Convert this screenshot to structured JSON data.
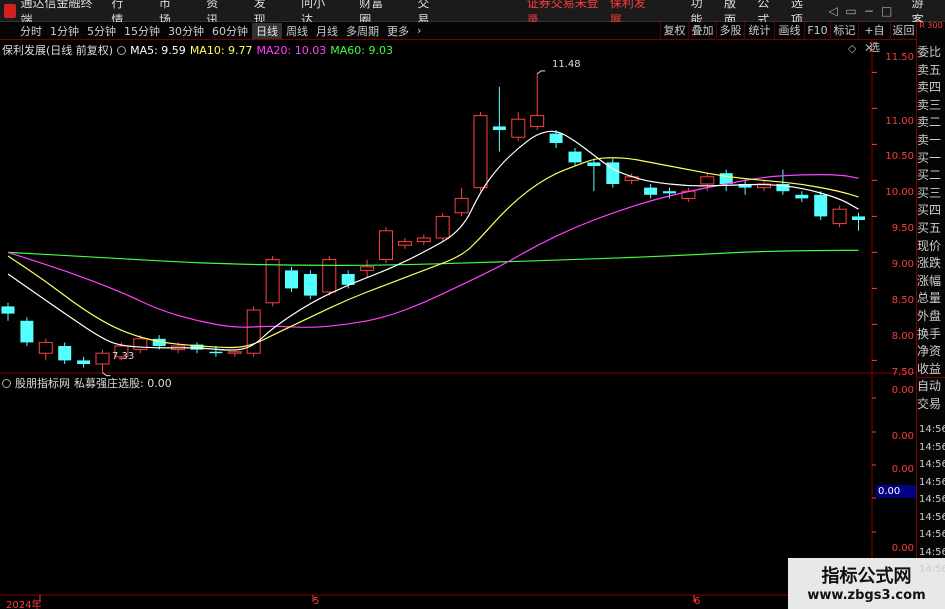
{
  "app": {
    "title": "通达信金融终端",
    "warning": "证券交易未登录",
    "stock": "保利发展",
    "guest": "游客"
  },
  "menu": [
    "行情",
    "市场",
    "资讯",
    "发现",
    "问小达",
    "财富圈",
    "交易"
  ],
  "right_menu": [
    "功能",
    "版面",
    "公式",
    "选项"
  ],
  "periods": [
    "分时",
    "1分钟",
    "5分钟",
    "15分钟",
    "30分钟",
    "60分钟",
    "日线",
    "周线",
    "月线",
    "多周期",
    "更多"
  ],
  "active_period": "日线",
  "toolbar_right": [
    "复权",
    "叠加",
    "多股",
    "统计",
    "画线",
    "F10",
    "标记",
    "+自选",
    "返回"
  ],
  "chart_header": {
    "title": "保利发展(日线 前复权)",
    "ma5": "MA5: 9.59",
    "ma10": "MA10: 9.77",
    "ma20": "MA20: 10.03",
    "ma60": "MA60: 9.03"
  },
  "indicator": {
    "name": "股朋指标网",
    "formula": "私募强庄选股: 0.00",
    "value_box": "0.00"
  },
  "annotations": {
    "high": "11.48",
    "low": "7.33"
  },
  "price_axis": [
    "11.50",
    "11.00",
    "10.50",
    "10.00",
    "9.50",
    "9.00",
    "8.50",
    "8.00",
    "7.50"
  ],
  "indicator_axis": [
    "0.00",
    "0.00",
    "0.00",
    "0.00"
  ],
  "x_labels": [
    "2024年",
    "5",
    "6"
  ],
  "side_panel": [
    "委比",
    "卖五",
    "卖四",
    "卖三",
    "卖二",
    "卖一",
    "买一",
    "买二",
    "买三",
    "买四",
    "买五",
    "现价",
    "涨跌",
    "涨幅",
    "总量",
    "外盘",
    "换手",
    "净资",
    "收益",
    "自动",
    "交易"
  ],
  "times": [
    "14:56",
    "14:56",
    "14:56",
    "14:56",
    "14:56",
    "14:56",
    "14:56",
    "14:56",
    "14:56"
  ],
  "side_top": "R 300",
  "watermark": {
    "line1": "指标公式网",
    "line2": "www.zbgs3.com"
  },
  "colors": {
    "up": "#ff4040",
    "down": "#54ffff",
    "ma5": "#ffffff",
    "ma10": "#ffff60",
    "ma20": "#ff40ff",
    "ma60": "#40ff40",
    "axis": "#ff3b3b",
    "frame": "#8b0000"
  },
  "chart_data": {
    "type": "candlestick",
    "ylim": [
      7.2,
      11.7
    ],
    "candles": [
      {
        "o": 8.25,
        "c": 8.15,
        "h": 8.3,
        "l": 8.05
      },
      {
        "o": 8.05,
        "c": 7.75,
        "h": 8.1,
        "l": 7.7
      },
      {
        "o": 7.6,
        "c": 7.75,
        "h": 7.8,
        "l": 7.5
      },
      {
        "o": 7.7,
        "c": 7.5,
        "h": 7.75,
        "l": 7.45
      },
      {
        "o": 7.5,
        "c": 7.45,
        "h": 7.55,
        "l": 7.4
      },
      {
        "o": 7.45,
        "c": 7.6,
        "h": 7.65,
        "l": 7.33
      },
      {
        "o": 7.55,
        "c": 7.7,
        "h": 7.75,
        "l": 7.5
      },
      {
        "o": 7.65,
        "c": 7.8,
        "h": 7.85,
        "l": 7.6
      },
      {
        "o": 7.8,
        "c": 7.7,
        "h": 7.85,
        "l": 7.65
      },
      {
        "o": 7.65,
        "c": 7.7,
        "h": 7.75,
        "l": 7.6
      },
      {
        "o": 7.72,
        "c": 7.65,
        "h": 7.75,
        "l": 7.6
      },
      {
        "o": 7.62,
        "c": 7.6,
        "h": 7.7,
        "l": 7.55
      },
      {
        "o": 7.6,
        "c": 7.62,
        "h": 7.65,
        "l": 7.55
      },
      {
        "o": 7.6,
        "c": 8.2,
        "h": 8.25,
        "l": 7.55
      },
      {
        "o": 8.3,
        "c": 8.9,
        "h": 8.95,
        "l": 8.25
      },
      {
        "o": 8.75,
        "c": 8.5,
        "h": 8.8,
        "l": 8.45
      },
      {
        "o": 8.7,
        "c": 8.4,
        "h": 8.75,
        "l": 8.35
      },
      {
        "o": 8.45,
        "c": 8.9,
        "h": 8.95,
        "l": 8.4
      },
      {
        "o": 8.7,
        "c": 8.55,
        "h": 8.75,
        "l": 8.5
      },
      {
        "o": 8.75,
        "c": 8.8,
        "h": 8.9,
        "l": 8.65
      },
      {
        "o": 8.9,
        "c": 9.3,
        "h": 9.35,
        "l": 8.85
      },
      {
        "o": 9.1,
        "c": 9.15,
        "h": 9.2,
        "l": 9.05
      },
      {
        "o": 9.15,
        "c": 9.2,
        "h": 9.25,
        "l": 9.1
      },
      {
        "o": 9.2,
        "c": 9.5,
        "h": 9.55,
        "l": 9.15
      },
      {
        "o": 9.55,
        "c": 9.75,
        "h": 9.9,
        "l": 9.5
      },
      {
        "o": 9.9,
        "c": 10.9,
        "h": 10.95,
        "l": 9.85
      },
      {
        "o": 10.75,
        "c": 10.7,
        "h": 11.3,
        "l": 10.4
      },
      {
        "o": 10.6,
        "c": 10.85,
        "h": 10.95,
        "l": 10.55
      },
      {
        "o": 10.75,
        "c": 10.9,
        "h": 11.48,
        "l": 10.7
      },
      {
        "o": 10.65,
        "c": 10.52,
        "h": 10.7,
        "l": 10.45
      },
      {
        "o": 10.4,
        "c": 10.25,
        "h": 10.45,
        "l": 10.2
      },
      {
        "o": 10.25,
        "c": 10.2,
        "h": 10.3,
        "l": 9.85
      },
      {
        "o": 10.25,
        "c": 9.95,
        "h": 10.3,
        "l": 9.9
      },
      {
        "o": 10.0,
        "c": 10.05,
        "h": 10.1,
        "l": 9.95
      },
      {
        "o": 9.9,
        "c": 9.8,
        "h": 9.95,
        "l": 9.75
      },
      {
        "o": 9.85,
        "c": 9.82,
        "h": 9.9,
        "l": 9.75
      },
      {
        "o": 9.75,
        "c": 9.85,
        "h": 9.9,
        "l": 9.7
      },
      {
        "o": 9.95,
        "c": 10.05,
        "h": 10.1,
        "l": 9.85
      },
      {
        "o": 10.1,
        "c": 9.95,
        "h": 10.15,
        "l": 9.85
      },
      {
        "o": 9.95,
        "c": 9.9,
        "h": 10.0,
        "l": 9.8
      },
      {
        "o": 9.9,
        "c": 9.95,
        "h": 10.0,
        "l": 9.85
      },
      {
        "o": 9.95,
        "c": 9.85,
        "h": 10.15,
        "l": 9.8
      },
      {
        "o": 9.8,
        "c": 9.75,
        "h": 9.85,
        "l": 9.7
      },
      {
        "o": 9.8,
        "c": 9.5,
        "h": 9.85,
        "l": 9.45
      },
      {
        "o": 9.4,
        "c": 9.6,
        "h": 9.65,
        "l": 9.35
      },
      {
        "o": 9.5,
        "c": 9.45,
        "h": 9.55,
        "l": 9.3
      }
    ],
    "ma5": [
      [
        0,
        8.7
      ],
      [
        3,
        8.15
      ],
      [
        5,
        7.8
      ],
      [
        6,
        7.7
      ],
      [
        8,
        7.67
      ],
      [
        10,
        7.68
      ],
      [
        12,
        7.63
      ],
      [
        13,
        7.7
      ],
      [
        14,
        7.95
      ],
      [
        16,
        8.3
      ],
      [
        18,
        8.55
      ],
      [
        20,
        8.75
      ],
      [
        22,
        9.0
      ],
      [
        24,
        9.3
      ],
      [
        25,
        9.85
      ],
      [
        26,
        10.2
      ],
      [
        27,
        10.45
      ],
      [
        28,
        10.65
      ],
      [
        29,
        10.7
      ],
      [
        30,
        10.55
      ],
      [
        31,
        10.35
      ],
      [
        32,
        10.15
      ],
      [
        33,
        10.05
      ],
      [
        34,
        9.98
      ],
      [
        36,
        9.92
      ],
      [
        38,
        9.93
      ],
      [
        40,
        9.95
      ],
      [
        42,
        9.9
      ],
      [
        44,
        9.75
      ],
      [
        45,
        9.6
      ]
    ],
    "ma10": [
      [
        0,
        8.95
      ],
      [
        2,
        8.6
      ],
      [
        4,
        8.2
      ],
      [
        6,
        7.9
      ],
      [
        8,
        7.75
      ],
      [
        10,
        7.7
      ],
      [
        12,
        7.67
      ],
      [
        13,
        7.72
      ],
      [
        14,
        7.85
      ],
      [
        16,
        8.1
      ],
      [
        18,
        8.35
      ],
      [
        20,
        8.55
      ],
      [
        22,
        8.75
      ],
      [
        24,
        8.95
      ],
      [
        25,
        9.2
      ],
      [
        26,
        9.5
      ],
      [
        27,
        9.75
      ],
      [
        28,
        9.95
      ],
      [
        29,
        10.1
      ],
      [
        30,
        10.2
      ],
      [
        31,
        10.3
      ],
      [
        32,
        10.32
      ],
      [
        33,
        10.3
      ],
      [
        34,
        10.25
      ],
      [
        36,
        10.15
      ],
      [
        38,
        10.05
      ],
      [
        40,
        10.0
      ],
      [
        42,
        9.95
      ],
      [
        44,
        9.85
      ],
      [
        45,
        9.77
      ]
    ],
    "ma20": [
      [
        0,
        9.0
      ],
      [
        3,
        8.75
      ],
      [
        6,
        8.45
      ],
      [
        8,
        8.2
      ],
      [
        10,
        8.05
      ],
      [
        12,
        7.95
      ],
      [
        14,
        7.98
      ],
      [
        16,
        7.95
      ],
      [
        18,
        8.0
      ],
      [
        20,
        8.1
      ],
      [
        22,
        8.3
      ],
      [
        24,
        8.55
      ],
      [
        26,
        8.8
      ],
      [
        28,
        9.1
      ],
      [
        30,
        9.35
      ],
      [
        32,
        9.55
      ],
      [
        34,
        9.72
      ],
      [
        36,
        9.85
      ],
      [
        38,
        9.95
      ],
      [
        40,
        10.05
      ],
      [
        42,
        10.08
      ],
      [
        44,
        10.08
      ],
      [
        45,
        10.03
      ]
    ],
    "ma60": [
      [
        0,
        9.0
      ],
      [
        5,
        8.93
      ],
      [
        10,
        8.85
      ],
      [
        15,
        8.82
      ],
      [
        20,
        8.82
      ],
      [
        25,
        8.86
      ],
      [
        30,
        8.9
      ],
      [
        35,
        8.95
      ],
      [
        40,
        9.02
      ],
      [
        45,
        9.03
      ]
    ]
  }
}
